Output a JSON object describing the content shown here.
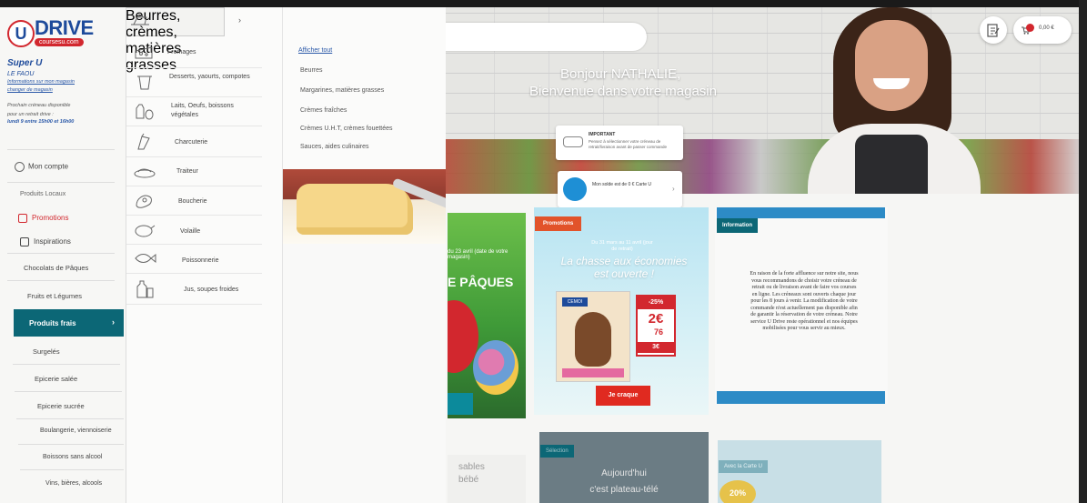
{
  "logo": {
    "brand": "DRIVE",
    "letter": "U",
    "sub": "coursesu.com"
  },
  "store": {
    "name": "Super U",
    "town": "LE FAOU",
    "info_link": "Informations sur mon magasin",
    "change_link": "changer de magasin",
    "slot_line1": "Prochain créneau disponible",
    "slot_line2": "pour un retrait drive :",
    "slot_time": "lundi 9 entre 15h00 et 16h00"
  },
  "sidebar": {
    "account": "Mon compte",
    "local": "Produits Locaux",
    "promotions": "Promotions",
    "inspirations": "Inspirations",
    "categories": [
      "Chocolats de Pâques",
      "Fruits et Légumes",
      "Produits frais",
      "Surgelés",
      "Epicerie salée",
      "Epicerie sucrée",
      "Boulangerie, viennoiserie",
      "Boissons sans alcool",
      "Vins, bières, alcools"
    ],
    "active_chevron": "›"
  },
  "submenu": {
    "items": [
      {
        "label": "Beurres, crèmes, matières grasses"
      },
      {
        "label": "Fromages"
      },
      {
        "label": "Desserts, yaourts, compotes"
      },
      {
        "label": "Laits, Oeufs, boissons végétales"
      },
      {
        "label": "Charcuterie"
      },
      {
        "label": "Traiteur"
      },
      {
        "label": "Boucherie"
      },
      {
        "label": "Volaille"
      },
      {
        "label": "Poissonnerie"
      },
      {
        "label": "Jus, soupes froides"
      }
    ],
    "chevron": "›"
  },
  "subsubmenu": {
    "all": "Afficher tout",
    "items": [
      "Beurres",
      "Margarines, matières grasses",
      "Crèmes fraîches",
      "Crèmes U.H.T, crèmes fouettées",
      "Sauces, aides culinaires"
    ]
  },
  "hero": {
    "greeting1": "Bonjour NATHALIE,",
    "greeting2": "Bienvenue dans votre magasin",
    "cart_amount": "0,00 €",
    "notice_title": "IMPORTANT",
    "notice_text": "Pensez à sélectionner votre créneau de retrait/livraison avant de passer commande",
    "balance_text": "Mon solde est de 0 € Carte U",
    "balance_chevron": "›"
  },
  "cards": {
    "easter_date": "du 23 avril (date de votre magasin)",
    "easter_title": "E PÂQUES",
    "promo_tag": "Promotions",
    "promo_dates": "Du 31 mars au 11 avril (jour de retrait)",
    "promo_hunt": "La chasse aux économies est ouverte !",
    "promo_brand": "CEMOI",
    "promo_pct": "-25%",
    "promo_price": "2€",
    "promo_decimal": "76",
    "promo_bottom": "3€",
    "promo_cta": "Je craque",
    "info_tag": "Information",
    "info_text": "En raison de la forte affluence sur notre site, nous vous recommandons de choisir votre créneau de retrait ou de livraison avant de faire vos courses en ligne. Les créneaux sont ouverts chaque jour pour les 8 jours à venir. La modification de votre commande n'est actuellement pas disponible afin de garantir la réservation de votre créneau. Notre service U Drive reste opérationnel et nos équipes mobilisées pour vous servir au mieux.",
    "bottom1_l1": "sables",
    "bottom1_l2": "bébé",
    "bottom2_tag": "Sélection",
    "bottom2_l1": "Aujourd'hui",
    "bottom2_l2": "c'est plateau-télé",
    "bottom3_tag": "Avec la Carte U",
    "bottom3_disc": "20%"
  },
  "colors": {
    "brand_blue": "#1e4b9b",
    "brand_red": "#d2272e",
    "teal": "#0c6776"
  }
}
